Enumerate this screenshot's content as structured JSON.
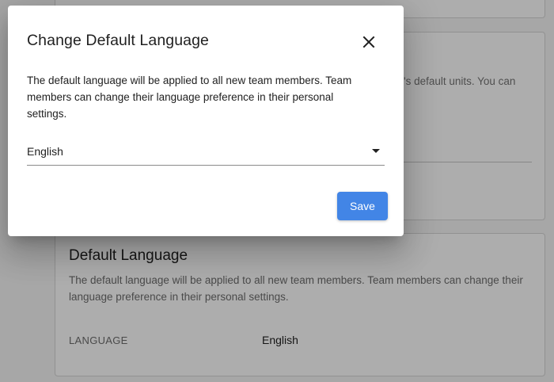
{
  "background": {
    "units_card": {
      "description_fragment_line1": "'s default units. You can"
    },
    "language_card": {
      "title": "Default Language",
      "description": "The default language will be applied to all new team members. Team members can change their language preference in their personal settings.",
      "field_label": "LANGUAGE",
      "field_value": "English"
    }
  },
  "dialog": {
    "title": "Change Default Language",
    "close_icon": "close-icon",
    "description": "The default language will be applied to all new team members. Team members can change their language preference in their personal settings.",
    "language_select": {
      "selected": "English"
    },
    "save_label": "Save"
  },
  "colors": {
    "accent": "#4285e6",
    "scrim": "rgba(0,0,0,0.32)"
  }
}
